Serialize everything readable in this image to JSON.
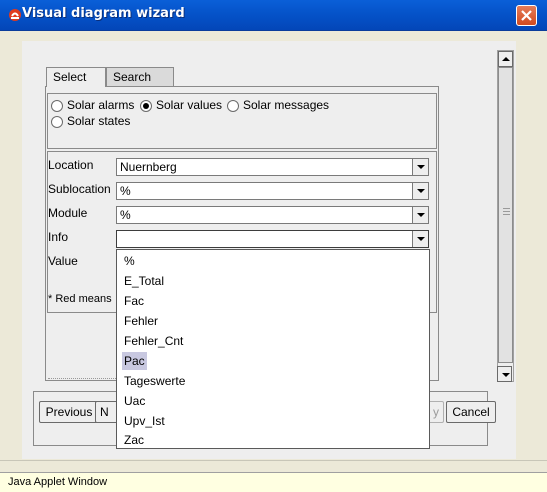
{
  "window": {
    "title": "Visual diagram wizard",
    "status": "Java Applet Window",
    "colors": {
      "titlebar": "#0553c9",
      "close": "#d24a1f",
      "selection": "#c8c8e0"
    }
  },
  "tabs": [
    {
      "label": "Select",
      "active": true
    },
    {
      "label": "Search",
      "active": false
    }
  ],
  "radios": [
    {
      "label": "Solar alarms",
      "checked": false
    },
    {
      "label": "Solar values",
      "checked": true
    },
    {
      "label": "Solar messages",
      "checked": false
    },
    {
      "label": "Solar states",
      "checked": false
    }
  ],
  "form": {
    "location": {
      "label": "Location",
      "value": "Nuernberg"
    },
    "sublocation": {
      "label": "Sublocation",
      "value": "%"
    },
    "module": {
      "label": "Module",
      "value": "%"
    },
    "info": {
      "label": "Info",
      "value": ""
    },
    "value": {
      "label": "Value"
    }
  },
  "note": "* Red means",
  "dropdown": {
    "options": [
      "%",
      "E_Total",
      "Fac",
      "Fehler",
      "Fehler_Cnt",
      "Pac",
      "Tageswerte",
      "Uac",
      "Upv_Ist",
      "Zac"
    ],
    "highlighted": "Pac"
  },
  "buttons": {
    "previous": "Previous",
    "next_partial": "N",
    "finish_partial": "y",
    "cancel": "Cancel"
  }
}
